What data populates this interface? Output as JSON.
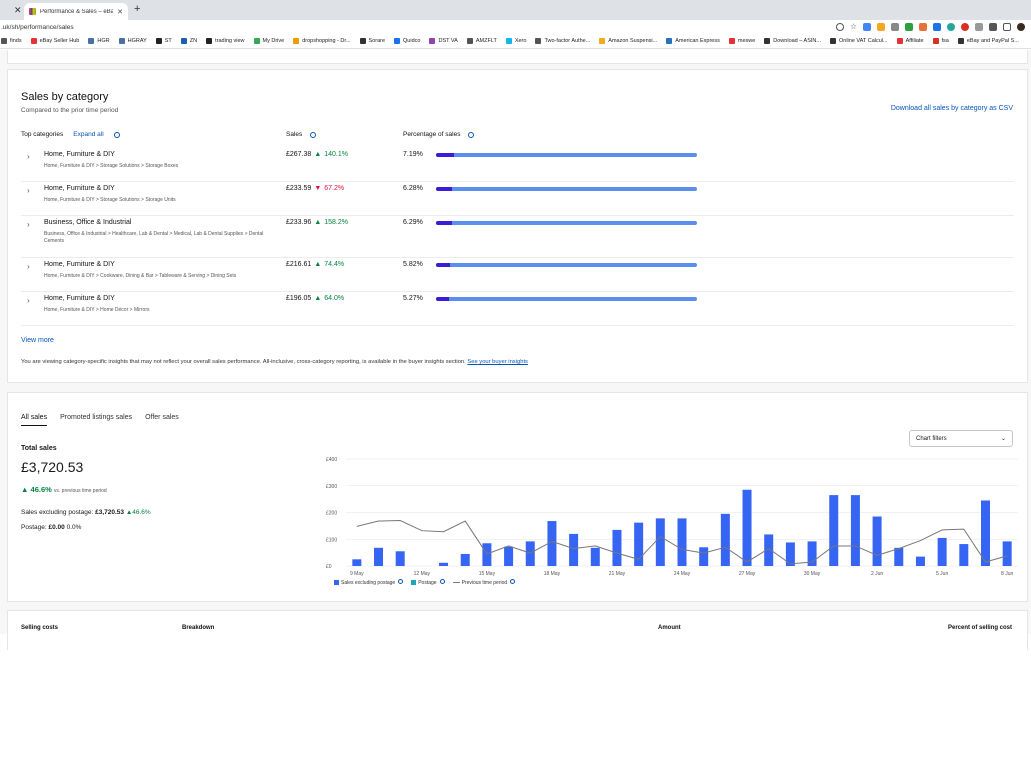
{
  "browser": {
    "tab_title": "Performance & Sales – eBay S",
    "url": ".uk/sh/performance/sales",
    "bookmarks": [
      "finds",
      "eBay Seller Hub",
      "HGR",
      "HGRAY",
      "ST",
      "ZN",
      "trading view",
      "My Drive",
      "dropshopping - Dr...",
      "Sorare",
      "Quidco",
      "DST VA",
      "AMZFLT",
      "Xero",
      "Two-factor Authe...",
      "Amazon Suspensi...",
      "American Express",
      "meswe",
      "Download – ASIN...",
      "Online VAT Calcul...",
      "Affiliate",
      "fsa",
      "eBay and PayPal S..."
    ]
  },
  "category": {
    "title": "Sales by category",
    "subtitle": "Compared to the prior time period",
    "csv_link": "Download all sales by category as CSV",
    "col_top": "Top categories",
    "expand_all": "Expand all",
    "col_sales": "Sales",
    "col_pct": "Percentage of sales",
    "rows": [
      {
        "name": "Home, Furniture & DIY",
        "path": "Home, Furniture & DIY > Storage Solutions > Storage Boxes",
        "sales": "£267.38",
        "change": "140.1%",
        "dir": "up",
        "pct_label": "7.19%",
        "pct": 7.19
      },
      {
        "name": "Home, Furniture & DIY",
        "path": "Home, Furniture & DIY > Storage Solutions > Storage Units",
        "sales": "£233.59",
        "change": "67.2%",
        "dir": "down",
        "pct_label": "6.28%",
        "pct": 6.28
      },
      {
        "name": "Business, Office & Industrial",
        "path": "Business, Office & Industrial > Healthcare, Lab & Dental > Medical, Lab & Dental Supplies > Dental Cements",
        "sales": "£233.96",
        "change": "158.2%",
        "dir": "up",
        "pct_label": "6.29%",
        "pct": 6.29
      },
      {
        "name": "Home, Furniture & DIY",
        "path": "Home, Furniture & DIY > Cookware, Dining & Bar > Tableware & Serving > Dining Sets",
        "sales": "£216.61",
        "change": "74.4%",
        "dir": "up",
        "pct_label": "5.82%",
        "pct": 5.82
      },
      {
        "name": "Home, Furniture & DIY",
        "path": "Home, Furniture & DIY > Home Décor > Mirrors",
        "sales": "£196.05",
        "change": "64.0%",
        "dir": "up",
        "pct_label": "5.27%",
        "pct": 5.27
      }
    ],
    "view_more": "View more",
    "notice": "You are viewing category-specific insights that may not reflect your overall sales performance. All-inclusive, cross-category reporting, is available in the buyer insights section.",
    "notice_link": "See your buyer insights"
  },
  "sales": {
    "tabs": [
      "All sales",
      "Promoted listings sales",
      "Offer sales"
    ],
    "total_label": "Total sales",
    "total_value": "£3,720.53",
    "delta": "46.6%",
    "delta_note": "vs. previous time period",
    "excl_label": "Sales excluding postage:",
    "excl_value": "£3,720.53",
    "excl_delta": "46.6%",
    "post_label": "Postage:",
    "post_value": "£0.00",
    "post_delta": "0.0%",
    "chart_filters": "Chart filters"
  },
  "chart_data": {
    "type": "bar",
    "ytick_labels": [
      "£0",
      "£100",
      "£200",
      "£300",
      "£400"
    ],
    "ylim": [
      0,
      400
    ],
    "xtick_labels": [
      "9 May",
      "12 May",
      "15 May",
      "18 May",
      "21 May",
      "24 May",
      "27 May",
      "30 May",
      "2 Jun",
      "5 Jun",
      "8 Jun"
    ],
    "series": [
      {
        "name": "Sales excluding postage",
        "color": "#3665f3",
        "values": [
          25,
          68,
          55,
          0,
          12,
          45,
          85,
          72,
          92,
          168,
          120,
          68,
          135,
          162,
          178,
          178,
          70,
          195,
          285,
          118,
          88,
          92,
          265,
          265,
          185,
          68,
          35,
          105,
          82,
          245,
          92
        ]
      },
      {
        "name": "Postage",
        "color": "#1ea7b8",
        "values": []
      },
      {
        "name": "Previous time period",
        "color": "#777777",
        "values": [
          148,
          168,
          170,
          132,
          128,
          168,
          45,
          75,
          48,
          92,
          65,
          75,
          48,
          25,
          110,
          62,
          48,
          70,
          15,
          65,
          8,
          15,
          75,
          75,
          40,
          65,
          95,
          135,
          138,
          15,
          38
        ]
      }
    ]
  },
  "costs": {
    "col1": "Selling costs",
    "col2": "Breakdown",
    "col3": "Amount",
    "col4": "Percent of selling cost"
  }
}
